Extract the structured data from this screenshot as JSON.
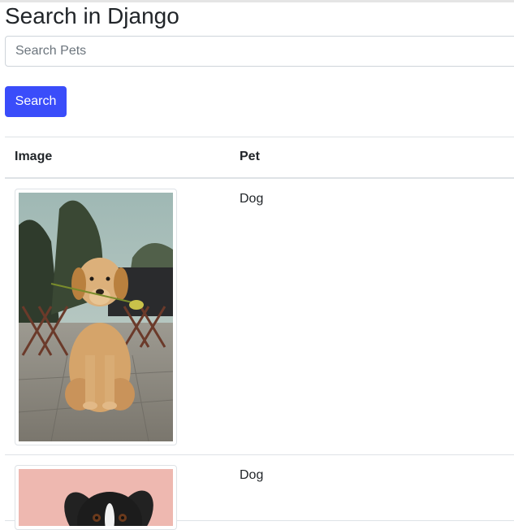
{
  "page": {
    "title": "Search in Django"
  },
  "search": {
    "placeholder": "Search Pets",
    "value": "",
    "button_label": "Search"
  },
  "table": {
    "headers": {
      "image": "Image",
      "pet": "Pet"
    },
    "rows": [
      {
        "pet": "Dog",
        "image_description": "golden retriever holding a tulip"
      },
      {
        "pet": "Dog",
        "image_description": "black and white dog on pink background"
      }
    ]
  },
  "colors": {
    "primary_button": "#3a4dfa",
    "border": "#dee2e6"
  }
}
